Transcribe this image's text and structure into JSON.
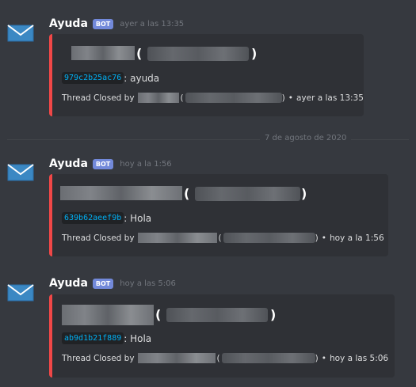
{
  "messages": [
    {
      "author": "Ayuda",
      "bot_tag": "BOT",
      "timestamp": "ayer a las 13:35",
      "thread_id": "979c2b25ac76",
      "thread_text": ": ayuda",
      "footer_prefix": "Thread Closed by",
      "footer_time": "ayer a las 13:35",
      "icon": "envelope-icon"
    },
    {
      "author": "Ayuda",
      "bot_tag": "BOT",
      "timestamp": "hoy a la 1:56",
      "thread_id": "639b62aeef9b",
      "thread_text": ": Hola",
      "footer_prefix": "Thread Closed by",
      "footer_time": "hoy a la 1:56",
      "icon": "envelope-icon"
    },
    {
      "author": "Ayuda",
      "bot_tag": "BOT",
      "timestamp": "hoy a las 5:06",
      "thread_id": "ab9d1b21f889",
      "thread_text": ": Hola",
      "footer_prefix": "Thread Closed by",
      "footer_time": "hoy a las 5:06",
      "icon": "envelope-icon"
    }
  ],
  "date_divider": "7 de agosto de 2020",
  "symbols": {
    "open_paren": "(",
    "close_paren": ")",
    "dot": "•"
  },
  "colors": {
    "background": "#36393f",
    "embed": "#2f3136",
    "embed_border": "#f04747",
    "bot_tag": "#7289da",
    "code": "#00b0f4"
  }
}
